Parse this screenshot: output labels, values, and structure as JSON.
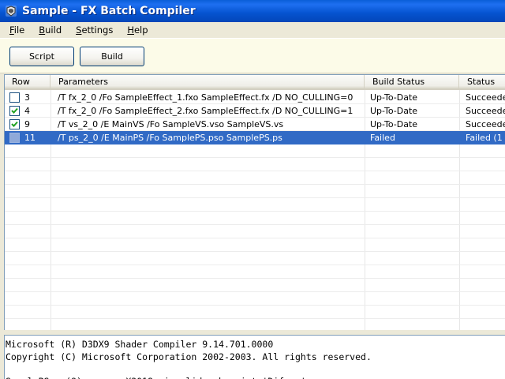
{
  "window": {
    "title": "Sample - FX Batch Compiler",
    "icon": "app-icon"
  },
  "menu": [
    {
      "label": "File",
      "accel": "F",
      "rest": "ile"
    },
    {
      "label": "Build",
      "accel": "B",
      "rest": "uild"
    },
    {
      "label": "Settings",
      "accel": "S",
      "rest": "ettings"
    },
    {
      "label": "Help",
      "accel": "H",
      "rest": "elp"
    }
  ],
  "toolbar": {
    "script_label": "Script",
    "build_label": "Build"
  },
  "list": {
    "columns": {
      "row": "Row",
      "params": "Parameters",
      "build_status": "Build Status",
      "status": "Status"
    },
    "rows": [
      {
        "checked": false,
        "row": "3",
        "params": "/T fx_2_0 /Fo SampleEffect_1.fxo SampleEffect.fx /D NO_CULLING=0",
        "build_status": "Up-To-Date",
        "status": "Succeeded",
        "selected": false
      },
      {
        "checked": true,
        "row": "4",
        "params": "/T fx_2_0 /Fo SampleEffect_2.fxo SampleEffect.fx /D NO_CULLING=1",
        "build_status": "Up-To-Date",
        "status": "Succeeded",
        "selected": false
      },
      {
        "checked": true,
        "row": "9",
        "params": "/T vs_2_0  /E MainVS  /Fo SampleVS.vso  SampleVS.vs",
        "build_status": "Up-To-Date",
        "status": "Succeeded",
        "selected": false
      },
      {
        "checked": false,
        "row": "11",
        "params": "/T ps_2_0  /E MainPS  /Fo SamplePS.pso  SamplePS.ps",
        "build_status": "Failed",
        "status": "Failed (1 er",
        "selected": true
      }
    ]
  },
  "output": {
    "lines": [
      "Microsoft (R) D3DX9 Shader Compiler 9.14.701.0000",
      "Copyright (C) Microsoft Corporation 2002-2003. All rights reserved.",
      "",
      "SamplePS.ps(9): error X3018: invalid subscript 'Difuse'"
    ]
  },
  "colors": {
    "selection": "#316ac5",
    "titlebar": "#0553d0"
  }
}
